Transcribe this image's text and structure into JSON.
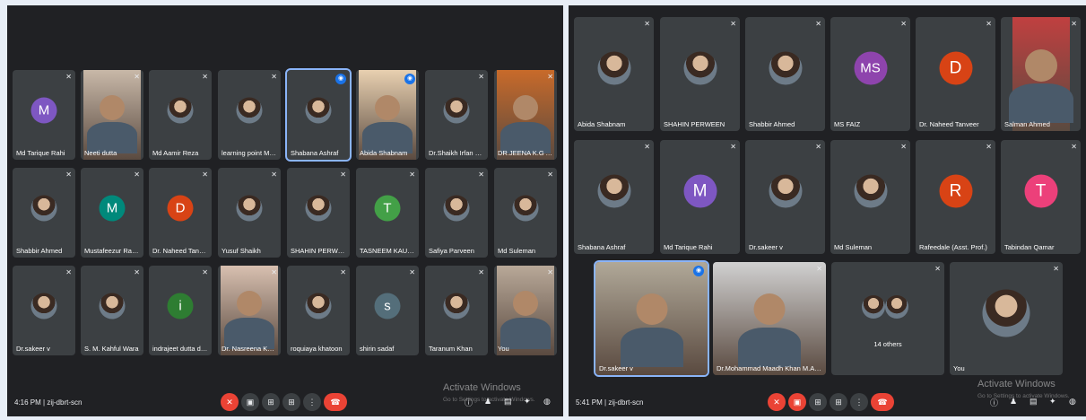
{
  "left": {
    "tiles": [
      {
        "name": "Md Tarique Rahi",
        "letter": "M",
        "color": "#7e57c2"
      },
      {
        "name": "Neeti dutta"
      },
      {
        "name": "Md Aamir Reza"
      },
      {
        "name": "learning point MS ..."
      },
      {
        "name": "Shabana Ashraf"
      },
      {
        "name": "Abida Shabnam"
      },
      {
        "name": "Dr.Shaikh Irfan Ja..."
      },
      {
        "name": "DR.JEENA K.G A..."
      },
      {
        "name": "Shabbir Ahmed"
      },
      {
        "name": "Mustafeezur Rah...",
        "letter": "M",
        "color": "#00897b"
      },
      {
        "name": "Dr. Naheed Tanveer",
        "letter": "D",
        "color": "#d84315"
      },
      {
        "name": "Yusuf Shaikh"
      },
      {
        "name": "SHAHIN PERWEEN"
      },
      {
        "name": "TASNEEM KAUSAR",
        "letter": "T",
        "color": "#43a047"
      },
      {
        "name": "Safiya Parveen"
      },
      {
        "name": "Md Suleman"
      },
      {
        "name": "Dr.sakeer v"
      },
      {
        "name": "S. M. Kahful Wara"
      },
      {
        "name": "indrajeet dutta du...",
        "letter": "i",
        "color": "#2e7d32"
      },
      {
        "name": "Dr. Nasreena Khan"
      },
      {
        "name": "roquiaya khatoon"
      },
      {
        "name": "shirin sadaf",
        "letter": "s",
        "color": "#546e7a"
      },
      {
        "name": "Taranum Khan"
      },
      {
        "name": "You"
      }
    ],
    "time": "4:16 PM",
    "meeting_code": "zij-dbrt-scn",
    "watermark": "Activate Windows",
    "watermark_sub": "Go to Settings to activate Windows."
  },
  "right": {
    "tiles": [
      {
        "name": "Abida Shabnam"
      },
      {
        "name": "SHAHIN PERWEEN"
      },
      {
        "name": "Shabbir Ahmed"
      },
      {
        "name": "MS FAIZ",
        "letter": "MS",
        "color": "#8e44ad"
      },
      {
        "name": "Dr. Naheed Tanveer",
        "letter": "D",
        "color": "#d84315"
      },
      {
        "name": "Salman Ahmed"
      },
      {
        "name": "Shabana Ashraf"
      },
      {
        "name": "Md Tarique Rahi",
        "letter": "M",
        "color": "#7e57c2"
      },
      {
        "name": "Dr.sakeer v"
      },
      {
        "name": "Md Suleman"
      },
      {
        "name": "Rafeedale (Asst. Prof.)",
        "letter": "R",
        "color": "#d84315"
      },
      {
        "name": "Tabindan Qamar",
        "letter": "T",
        "color": "#ec407a"
      },
      {
        "name": "Dr.sakeer v"
      },
      {
        "name": "Dr.Mohammad Maadh Khan M.A.L.T.I."
      },
      {
        "name": "14 others"
      },
      {
        "name": "You"
      }
    ],
    "time": "5:41 PM",
    "meeting_code": "zij-dbrt-scn",
    "watermark": "Activate Windows",
    "watermark_sub": "Go to Settings to activate Windows."
  },
  "icons": {
    "mic_off": "✕",
    "speaking": "◉",
    "cam": "▣",
    "present": "⊞",
    "raise": "✋",
    "more": "⋮",
    "end": "☎",
    "info": "ⓘ",
    "people": "♟",
    "chat": "▤",
    "activities": "✦",
    "lock": "◍"
  }
}
